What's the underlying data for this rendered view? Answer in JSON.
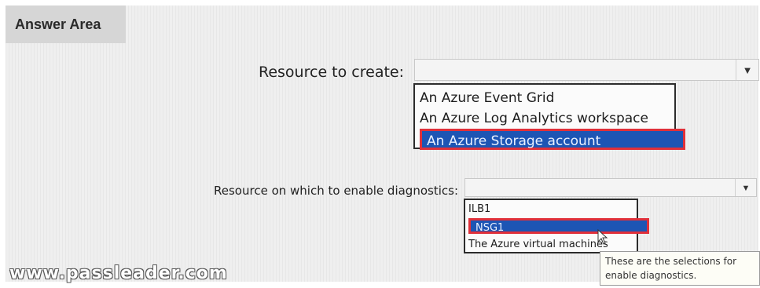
{
  "answer_area": {
    "title": "Answer Area"
  },
  "question1": {
    "label": "Resource to create:",
    "selected_value": "",
    "options": [
      {
        "label": "An Azure Event Grid",
        "selected": false
      },
      {
        "label": "An Azure Log Analytics workspace",
        "selected": false
      },
      {
        "label": "An Azure Storage account",
        "selected": true
      }
    ]
  },
  "question2": {
    "label": "Resource on which to enable diagnostics:",
    "selected_value": "",
    "options": [
      {
        "label": "ILB1",
        "selected": false
      },
      {
        "label": "NSG1",
        "selected": true
      },
      {
        "label": "The Azure virtual machines",
        "selected": false
      }
    ]
  },
  "tooltip": {
    "line1": "These are the selections for",
    "line2": "enable diagnostics."
  },
  "watermark": {
    "text": "www.passleader.com"
  },
  "icons": {
    "dropdown_arrow": "chevron-down-icon",
    "cursor": "mouse-pointer-icon"
  },
  "colors": {
    "selection_fill": "#1d55b4",
    "highlight_border": "#e0303a"
  }
}
